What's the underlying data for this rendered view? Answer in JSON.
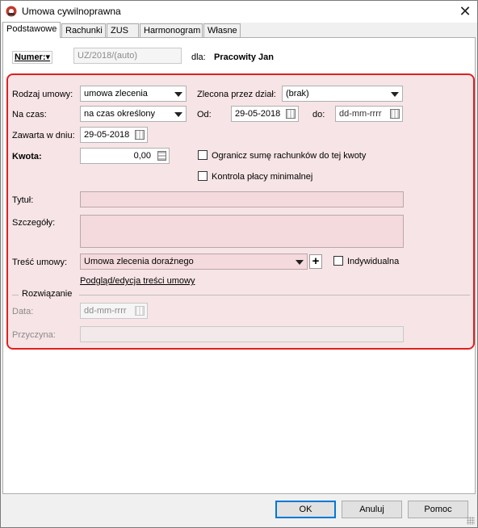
{
  "window": {
    "title": "Umowa cywilnoprawna",
    "app_icon": "app-logo-icon",
    "close_glyph": "✕"
  },
  "tabs": [
    {
      "label": "Podstawowe",
      "active": true
    },
    {
      "label": "Rachunki",
      "active": false
    },
    {
      "label": "ZUS",
      "active": false
    },
    {
      "label": "Harmonogram",
      "active": false
    },
    {
      "label": "Własne",
      "active": false
    }
  ],
  "header": {
    "numer_label": "Numer:",
    "numer_dropdown_glyph": "▾",
    "numer_value": "UZ/2018/(auto)",
    "dla_label": "dla:",
    "dla_value": "Pracowity Jan"
  },
  "form": {
    "rodzaj_label": "Rodzaj umowy:",
    "rodzaj_value": "umowa zlecenia",
    "zlecona_label": "Zlecona przez dział:",
    "zlecona_value": "(brak)",
    "na_czas_label": "Na czas:",
    "na_czas_value": "na czas określony",
    "od_label": "Od:",
    "od_value": "29-05-2018",
    "do_label": "do:",
    "do_value": "dd-mm-rrrr",
    "zawarta_label": "Zawarta w dniu:",
    "zawarta_value": "29-05-2018",
    "kwota_label": "Kwota:",
    "kwota_value": "0,00",
    "ogranicz_label": "Ogranicz sumę rachunków do tej kwoty",
    "ogranicz_checked": false,
    "kontrola_label": "Kontrola płacy minimalnej",
    "kontrola_checked": false,
    "tytul_label": "Tytuł:",
    "tytul_value": "",
    "szczegoly_label": "Szczegóły:",
    "szczegoly_value": "",
    "tresc_label": "Treść umowy:",
    "tresc_value": "Umowa zlecenia doraźnego",
    "tresc_add_glyph": "+",
    "indywidualna_label": "Indywidualna",
    "indywidualna_checked": false,
    "podglad_link": "Podgląd/edycja treści umowy"
  },
  "rozwiazanie": {
    "section_label": "Rozwiązanie",
    "data_label": "Data:",
    "data_value": "dd-mm-rrrr",
    "przyczyna_label": "Przyczyna:",
    "przyczyna_value": ""
  },
  "buttons": {
    "ok": "OK",
    "anuluj": "Anuluj",
    "pomoc": "Pomoc"
  },
  "colors": {
    "highlight_border": "#e02020",
    "highlight_fill": "#f7e4e6",
    "field_pink": "#f4dadd"
  }
}
